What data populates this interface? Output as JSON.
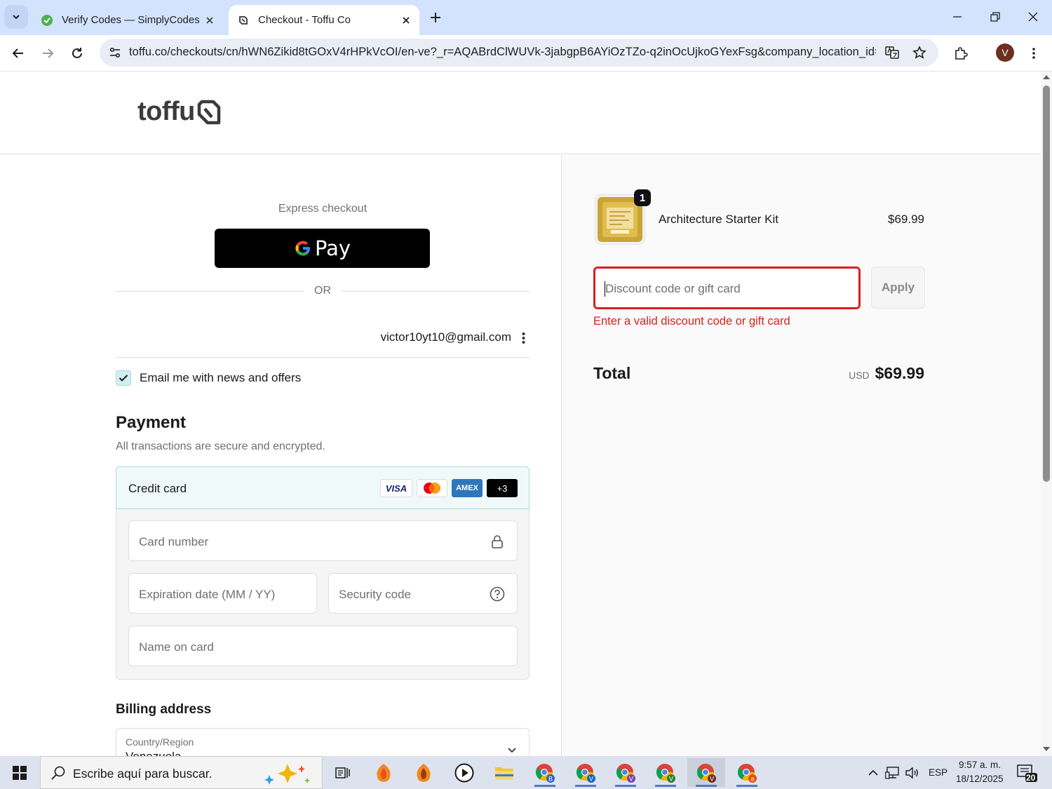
{
  "browser": {
    "tabs": [
      {
        "title": "Verify Codes — SimplyCodes",
        "active": false
      },
      {
        "title": "Checkout - Toffu Co",
        "active": true
      }
    ],
    "url": "toffu.co/checkouts/cn/hWN6Zikid8tGOxV4rHPkVcOI/en-ve?_r=AQABrdClWUVk-3jabgpB6AYiOzTZo-q2inOcUjkoGYexFsg&company_location_id=...",
    "profile_initial": "V"
  },
  "store": {
    "logo_text": "toffu"
  },
  "checkout": {
    "express_label": "Express checkout",
    "gpay_label": "Pay",
    "or_label": "OR",
    "email": "victor10yt10@gmail.com",
    "newsletter_label": "Email me with news and offers",
    "newsletter_checked": true,
    "payment_title": "Payment",
    "payment_subtitle": "All transactions are secure and encrypted.",
    "credit_card_label": "Credit card",
    "card_brands": [
      "VISA",
      "AMEX",
      "+3"
    ],
    "card_number_placeholder": "Card number",
    "expiration_placeholder": "Expiration date (MM / YY)",
    "security_placeholder": "Security code",
    "name_placeholder": "Name on card",
    "billing_title": "Billing address",
    "country_label": "Country/Region",
    "country_value": "Venezuela"
  },
  "summary": {
    "product_name": "Architecture Starter Kit",
    "product_qty": "1",
    "product_price": "$69.99",
    "discount_placeholder": "Discount code or gift card",
    "apply_label": "Apply",
    "discount_error": "Enter a valid discount code or gift card",
    "total_label": "Total",
    "currency": "USD",
    "total_value": "$69.99"
  },
  "taskbar": {
    "search_placeholder": "Escribe aquí para buscar.",
    "language": "ESP",
    "time": "9:57 a. m.",
    "date": "18/12/2025",
    "notification_count": "20"
  },
  "colors": {
    "accent_teal": "#a8dde0",
    "error_red": "#dd1d1d",
    "tabbar_blue": "#d3e3fd"
  }
}
